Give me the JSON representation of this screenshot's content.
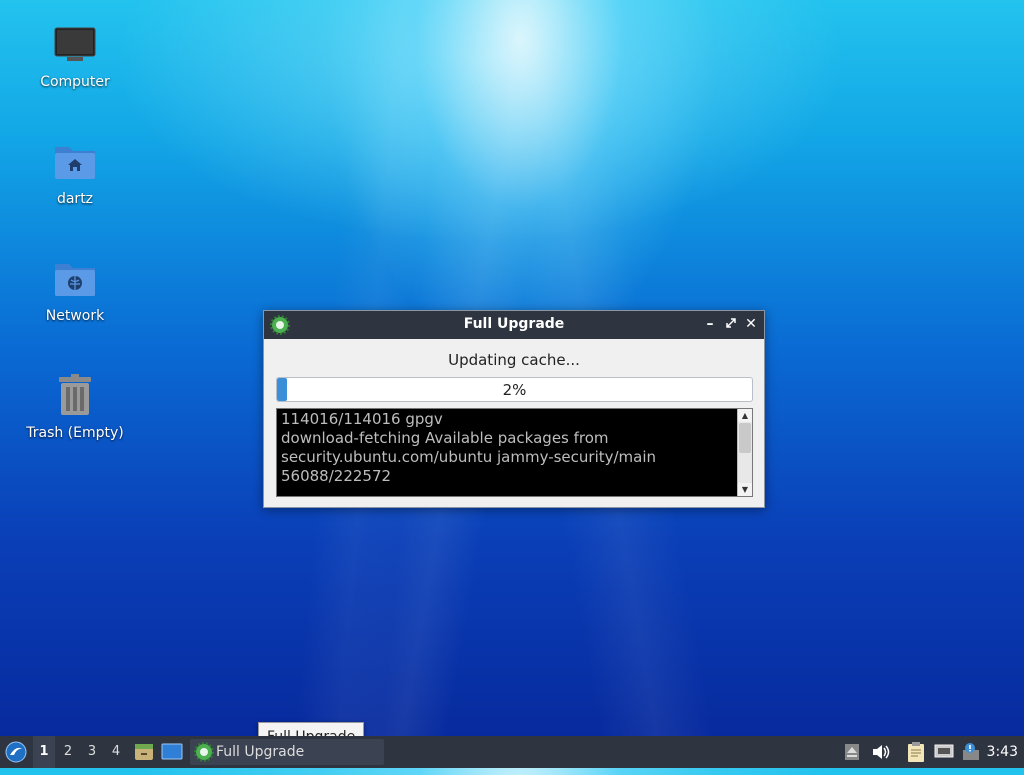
{
  "desktop": {
    "icons": [
      {
        "label": "Computer",
        "icon": "computer-icon"
      },
      {
        "label": "dartz",
        "icon": "home-folder-icon"
      },
      {
        "label": "Network",
        "icon": "network-folder-icon"
      },
      {
        "label": "Trash (Empty)",
        "icon": "trash-icon"
      }
    ]
  },
  "window": {
    "title": "Full Upgrade",
    "status": "Updating cache...",
    "progress": {
      "percent": 2,
      "label": "2%"
    },
    "log_lines": [
      "114016/114016 gpgv",
      "download-fetching Available packages from",
      "security.ubuntu.com/ubuntu jammy-security/main",
      "56088/222572"
    ]
  },
  "tooltip": {
    "text": "Full Upgrade"
  },
  "taskbar": {
    "workspaces": [
      "1",
      "2",
      "3",
      "4"
    ],
    "active_workspace": "1",
    "task": {
      "label": "Full Upgrade"
    },
    "clock": "3:43"
  },
  "colors": {
    "accent": "#3b8fd9",
    "taskbar": "#2e3440"
  }
}
